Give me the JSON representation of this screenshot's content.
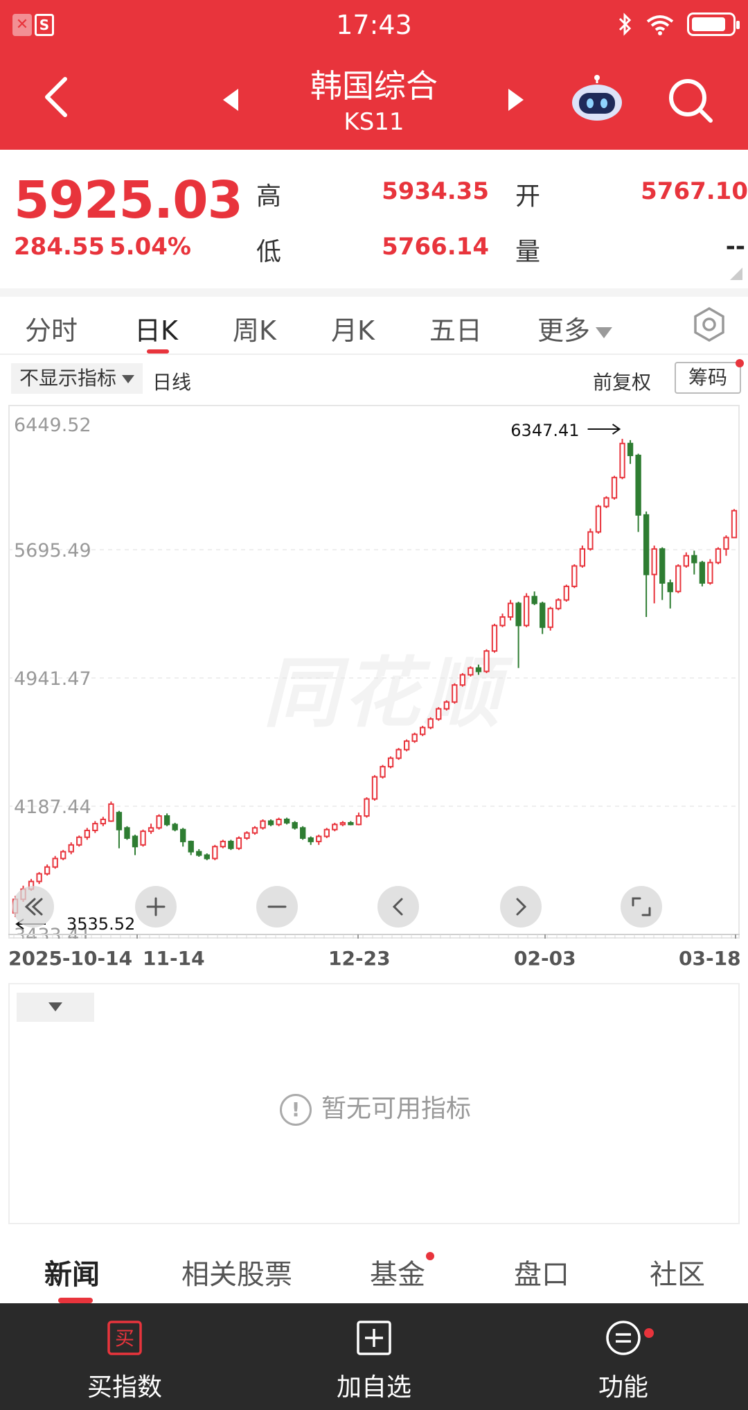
{
  "status_bar": {
    "time": "17:43",
    "left_icons": [
      "close-icon",
      "s-app-icon"
    ],
    "right_icons": [
      "bluetooth-icon",
      "wifi-icon",
      "battery-icon"
    ]
  },
  "header": {
    "title": "韩国综合",
    "code": "KS11",
    "bg_color": "#e8343c"
  },
  "quote": {
    "price": "5925.03",
    "change": "284.55",
    "change_pct": "5.04%",
    "high_label": "高",
    "high": "5934.35",
    "low_label": "低",
    "low": "5766.14",
    "open_label": "开",
    "open": "5767.10",
    "volume_label": "量",
    "volume": "--",
    "up_color": "#e8343c"
  },
  "tabs": [
    {
      "label": "分时",
      "active": false
    },
    {
      "label": "日K",
      "active": true
    },
    {
      "label": "周K",
      "active": false
    },
    {
      "label": "月K",
      "active": false
    },
    {
      "label": "五日",
      "active": false
    },
    {
      "label": "更多",
      "active": false
    }
  ],
  "chart_toolbar": {
    "indicator_select": "不显示指标",
    "period": "日线",
    "adjust": "前复权",
    "chips": "筹码"
  },
  "chart_data": {
    "type": "candlestick",
    "y_ticks": [
      "6449.52",
      "5695.49",
      "4941.47",
      "4187.44",
      "3433.41"
    ],
    "ylim": [
      3433.41,
      6449.52
    ],
    "x_ticks": [
      "2025-10-14",
      "11-14",
      "12-23",
      "02-03",
      "03-18"
    ],
    "max_marker": "6347.41",
    "min_marker": "3535.52",
    "candles": [
      [
        3560,
        3640,
        3535.52,
        3660
      ],
      [
        3640,
        3700,
        3625,
        3720
      ],
      [
        3700,
        3745,
        3690,
        3760
      ],
      [
        3745,
        3790,
        3730,
        3800
      ],
      [
        3790,
        3830,
        3780,
        3845
      ],
      [
        3830,
        3880,
        3820,
        3895
      ],
      [
        3880,
        3920,
        3870,
        3930
      ],
      [
        3920,
        3960,
        3905,
        3975
      ],
      [
        3960,
        4005,
        3950,
        4015
      ],
      [
        4005,
        4045,
        3990,
        4060
      ],
      [
        4045,
        4085,
        4030,
        4100
      ],
      [
        4085,
        4110,
        4070,
        4125
      ],
      [
        4100,
        4200,
        4095,
        4215
      ],
      [
        4150,
        4050,
        3940,
        4160
      ],
      [
        4060,
        4000,
        3990,
        4070
      ],
      [
        4010,
        3950,
        3900,
        4020
      ],
      [
        3960,
        4040,
        3950,
        4050
      ],
      [
        4040,
        4060,
        4025,
        4085
      ],
      [
        4060,
        4130,
        4050,
        4140
      ],
      [
        4130,
        4080,
        4070,
        4145
      ],
      [
        4080,
        4050,
        4040,
        4090
      ],
      [
        4050,
        3980,
        3950,
        4060
      ],
      [
        3980,
        3920,
        3900,
        3985
      ],
      [
        3920,
        3900,
        3890,
        3935
      ],
      [
        3900,
        3880,
        3870,
        3910
      ],
      [
        3880,
        3950,
        3870,
        3960
      ],
      [
        3950,
        3980,
        3940,
        3990
      ],
      [
        3980,
        3940,
        3930,
        3990
      ],
      [
        3940,
        4000,
        3930,
        4010
      ],
      [
        4000,
        4030,
        3990,
        4040
      ],
      [
        4030,
        4060,
        4020,
        4070
      ],
      [
        4060,
        4100,
        4050,
        4110
      ],
      [
        4100,
        4080,
        4070,
        4110
      ],
      [
        4080,
        4110,
        4070,
        4120
      ],
      [
        4110,
        4090,
        4080,
        4120
      ],
      [
        4090,
        4060,
        4050,
        4100
      ],
      [
        4060,
        4000,
        3990,
        4070
      ],
      [
        4000,
        3980,
        3960,
        4010
      ],
      [
        3980,
        4010,
        3960,
        4020
      ],
      [
        4010,
        4050,
        4000,
        4060
      ],
      [
        4050,
        4080,
        4040,
        4090
      ],
      [
        4080,
        4090,
        4070,
        4100
      ],
      [
        4090,
        4080,
        4075,
        4100
      ],
      [
        4080,
        4130,
        4075,
        4150
      ],
      [
        4130,
        4230,
        4120,
        4240
      ],
      [
        4230,
        4360,
        4220,
        4370
      ],
      [
        4360,
        4420,
        4350,
        4430
      ],
      [
        4420,
        4470,
        4410,
        4480
      ],
      [
        4470,
        4520,
        4460,
        4530
      ],
      [
        4520,
        4570,
        4510,
        4580
      ],
      [
        4570,
        4610,
        4560,
        4620
      ],
      [
        4610,
        4650,
        4600,
        4660
      ],
      [
        4650,
        4700,
        4640,
        4710
      ],
      [
        4700,
        4760,
        4690,
        4770
      ],
      [
        4760,
        4800,
        4750,
        4810
      ],
      [
        4800,
        4900,
        4790,
        4910
      ],
      [
        4900,
        4960,
        4890,
        4970
      ],
      [
        4960,
        5000,
        4950,
        5010
      ],
      [
        5000,
        4980,
        4960,
        5020
      ],
      [
        4980,
        5100,
        4970,
        5110
      ],
      [
        5100,
        5250,
        5090,
        5260
      ],
      [
        5250,
        5300,
        5240,
        5320
      ],
      [
        5300,
        5380,
        5280,
        5400
      ],
      [
        5380,
        5250,
        5000,
        5390
      ],
      [
        5250,
        5420,
        5240,
        5440
      ],
      [
        5420,
        5380,
        5370,
        5450
      ],
      [
        5380,
        5240,
        5200,
        5390
      ],
      [
        5240,
        5350,
        5220,
        5360
      ],
      [
        5350,
        5400,
        5340,
        5410
      ],
      [
        5400,
        5480,
        5390,
        5490
      ],
      [
        5480,
        5600,
        5470,
        5610
      ],
      [
        5600,
        5700,
        5590,
        5720
      ],
      [
        5700,
        5800,
        5690,
        5820
      ],
      [
        5800,
        5950,
        5790,
        5960
      ],
      [
        5950,
        6000,
        5940,
        6010
      ],
      [
        6000,
        6120,
        5990,
        6130
      ],
      [
        6120,
        6320,
        6110,
        6347.41
      ],
      [
        6320,
        6250,
        6200,
        6340
      ],
      [
        6250,
        5900,
        5800,
        6260
      ],
      [
        5900,
        5550,
        5300,
        5920
      ],
      [
        5550,
        5700,
        5380,
        5720
      ],
      [
        5700,
        5500,
        5400,
        5710
      ],
      [
        5500,
        5450,
        5350,
        5520
      ],
      [
        5450,
        5600,
        5440,
        5610
      ],
      [
        5600,
        5660,
        5590,
        5680
      ],
      [
        5660,
        5620,
        5550,
        5690
      ],
      [
        5620,
        5500,
        5480,
        5630
      ],
      [
        5500,
        5620,
        5490,
        5640
      ],
      [
        5620,
        5700,
        5610,
        5710
      ],
      [
        5700,
        5767.1,
        5660,
        5780
      ],
      [
        5767.1,
        5925.03,
        5766.14,
        5934.35
      ]
    ],
    "up_color": "#e8343c",
    "down_color": "#2e7d32",
    "grid": true
  },
  "chart_controls": [
    "double-left-icon",
    "zoom-in-icon",
    "zoom-out-icon",
    "chevron-left-icon",
    "chevron-right-icon",
    "fullscreen-icon"
  ],
  "indicator_panel": {
    "empty_text": "暂无可用指标"
  },
  "bottom_tabs": [
    {
      "label": "新闻",
      "active": true
    },
    {
      "label": "相关股票",
      "active": false
    },
    {
      "label": "基金",
      "active": false,
      "dot": true
    },
    {
      "label": "盘口",
      "active": false
    },
    {
      "label": "社区",
      "active": false
    }
  ],
  "footer": [
    {
      "label": "买指数",
      "icon": "buy-icon",
      "icon_text": "买"
    },
    {
      "label": "加自选",
      "icon": "add-watchlist-icon"
    },
    {
      "label": "功能",
      "icon": "menu-icon",
      "dot": true
    }
  ],
  "watermark": "同花顺"
}
